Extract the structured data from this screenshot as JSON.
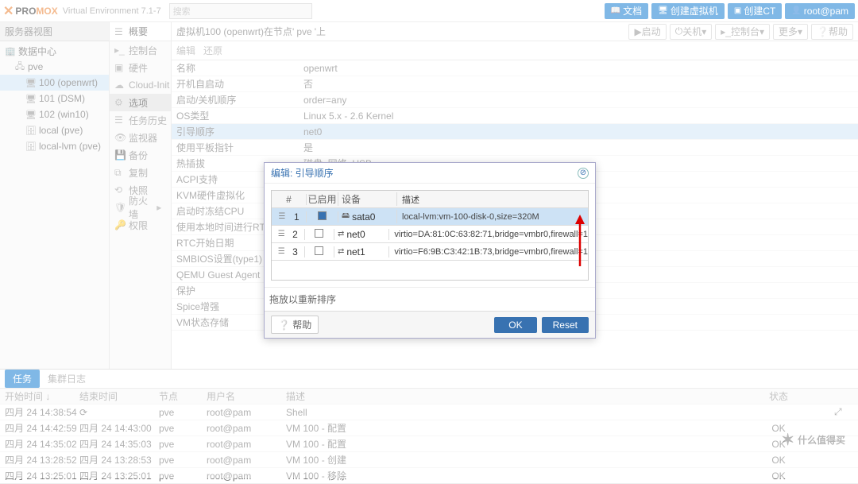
{
  "top": {
    "brand_pro": "PRO",
    "brand_mox": "MOX",
    "version": "Virtual Environment 7.1-7",
    "search_ph": "搜索",
    "btn_docs": "文档",
    "btn_createvm": "创建虚拟机",
    "btn_createct": "创建CT",
    "user": "root@pam"
  },
  "tree": {
    "header": "服务器视图",
    "dc": "数据中心",
    "node": "pve",
    "vm100": "100 (openwrt)",
    "vm101": "101 (DSM)",
    "vm102": "102 (win10)",
    "stor1": "local (pve)",
    "stor2": "local-lvm (pve)"
  },
  "side": {
    "summary": "概要",
    "console": "控制台",
    "hardware": "硬件",
    "cloudinit": "Cloud-Init",
    "options": "选项",
    "taskhist": "任务历史",
    "monitor": "监视器",
    "backup": "备份",
    "replication": "复制",
    "snapshot": "快照",
    "firewall": "防火墙",
    "permissions": "权限"
  },
  "crumb": {
    "pre": "虚拟机100 (openwrt)在节点'",
    "node": "pve",
    "post": "'上",
    "start": "启动",
    "shutdown": "关机",
    "console": "控制台",
    "more": "更多",
    "help": "帮助"
  },
  "toolbar": {
    "edit": "编辑",
    "revert": "还原"
  },
  "opts": [
    {
      "k": "名称",
      "v": "openwrt"
    },
    {
      "k": "开机自启动",
      "v": "否"
    },
    {
      "k": "启动/关机顺序",
      "v": "order=any"
    },
    {
      "k": "OS类型",
      "v": "Linux 5.x - 2.6 Kernel"
    },
    {
      "k": "引导顺序",
      "v": "net0"
    },
    {
      "k": "使用平板指针",
      "v": "是"
    },
    {
      "k": "热插拔",
      "v": "磁盘, 网络, USB"
    },
    {
      "k": "ACPI支持",
      "v": ""
    },
    {
      "k": "KVM硬件虚拟化",
      "v": ""
    },
    {
      "k": "启动时冻结CPU",
      "v": ""
    },
    {
      "k": "使用本地时间进行RTC",
      "v": ""
    },
    {
      "k": "RTC开始日期",
      "v": ""
    },
    {
      "k": "SMBIOS设置(type1)",
      "v": ""
    },
    {
      "k": "QEMU Guest Agent",
      "v": ""
    },
    {
      "k": "保护",
      "v": ""
    },
    {
      "k": "Spice增强",
      "v": ""
    },
    {
      "k": "VM状态存储",
      "v": ""
    }
  ],
  "dialog": {
    "title": "编辑: 引导顺序",
    "col_num": "#",
    "col_enabled": "已启用",
    "col_device": "设备",
    "col_desc": "描述",
    "rows": [
      {
        "n": "1",
        "on": true,
        "dev": "sata0",
        "icon": "disk",
        "desc": "local-lvm:vm-100-disk-0,size=320M"
      },
      {
        "n": "2",
        "on": false,
        "dev": "net0",
        "icon": "net",
        "desc": "virtio=DA:81:0C:63:82:71,bridge=vmbr0,firewall=1"
      },
      {
        "n": "3",
        "on": false,
        "dev": "net1",
        "icon": "net",
        "desc": "virtio=F6:9B:C3:42:1B:73,bridge=vmbr0,firewall=1"
      }
    ],
    "draghint": "拖放以重新排序",
    "help": "帮助",
    "ok": "OK",
    "reset": "Reset"
  },
  "log": {
    "tab_tasks": "任务",
    "tab_cluster": "集群日志",
    "h_start": "开始时间 ↓",
    "h_end": "结束时间",
    "h_node": "节点",
    "h_user": "用户名",
    "h_desc": "描述",
    "h_status": "状态",
    "rows": [
      {
        "s": "四月 24 14:38:54",
        "e": "",
        "n": "pve",
        "u": "root@pam",
        "d": "Shell",
        "st": "",
        "run": true
      },
      {
        "s": "四月 24 14:42:59",
        "e": "四月 24 14:43:00",
        "n": "pve",
        "u": "root@pam",
        "d": "VM 100 - 配置",
        "st": "OK"
      },
      {
        "s": "四月 24 14:35:02",
        "e": "四月 24 14:35:03",
        "n": "pve",
        "u": "root@pam",
        "d": "VM 100 - 配置",
        "st": "OK"
      },
      {
        "s": "四月 24 13:28:52",
        "e": "四月 24 13:28:53",
        "n": "pve",
        "u": "root@pam",
        "d": "VM 100 - 创建",
        "st": "OK"
      },
      {
        "s": "四月 24 13:25:01",
        "e": "四月 24 13:25:01",
        "n": "pve",
        "u": "root@pam",
        "d": "VM 100 - 移除",
        "st": "OK"
      }
    ]
  },
  "watermark": "什么值得买"
}
